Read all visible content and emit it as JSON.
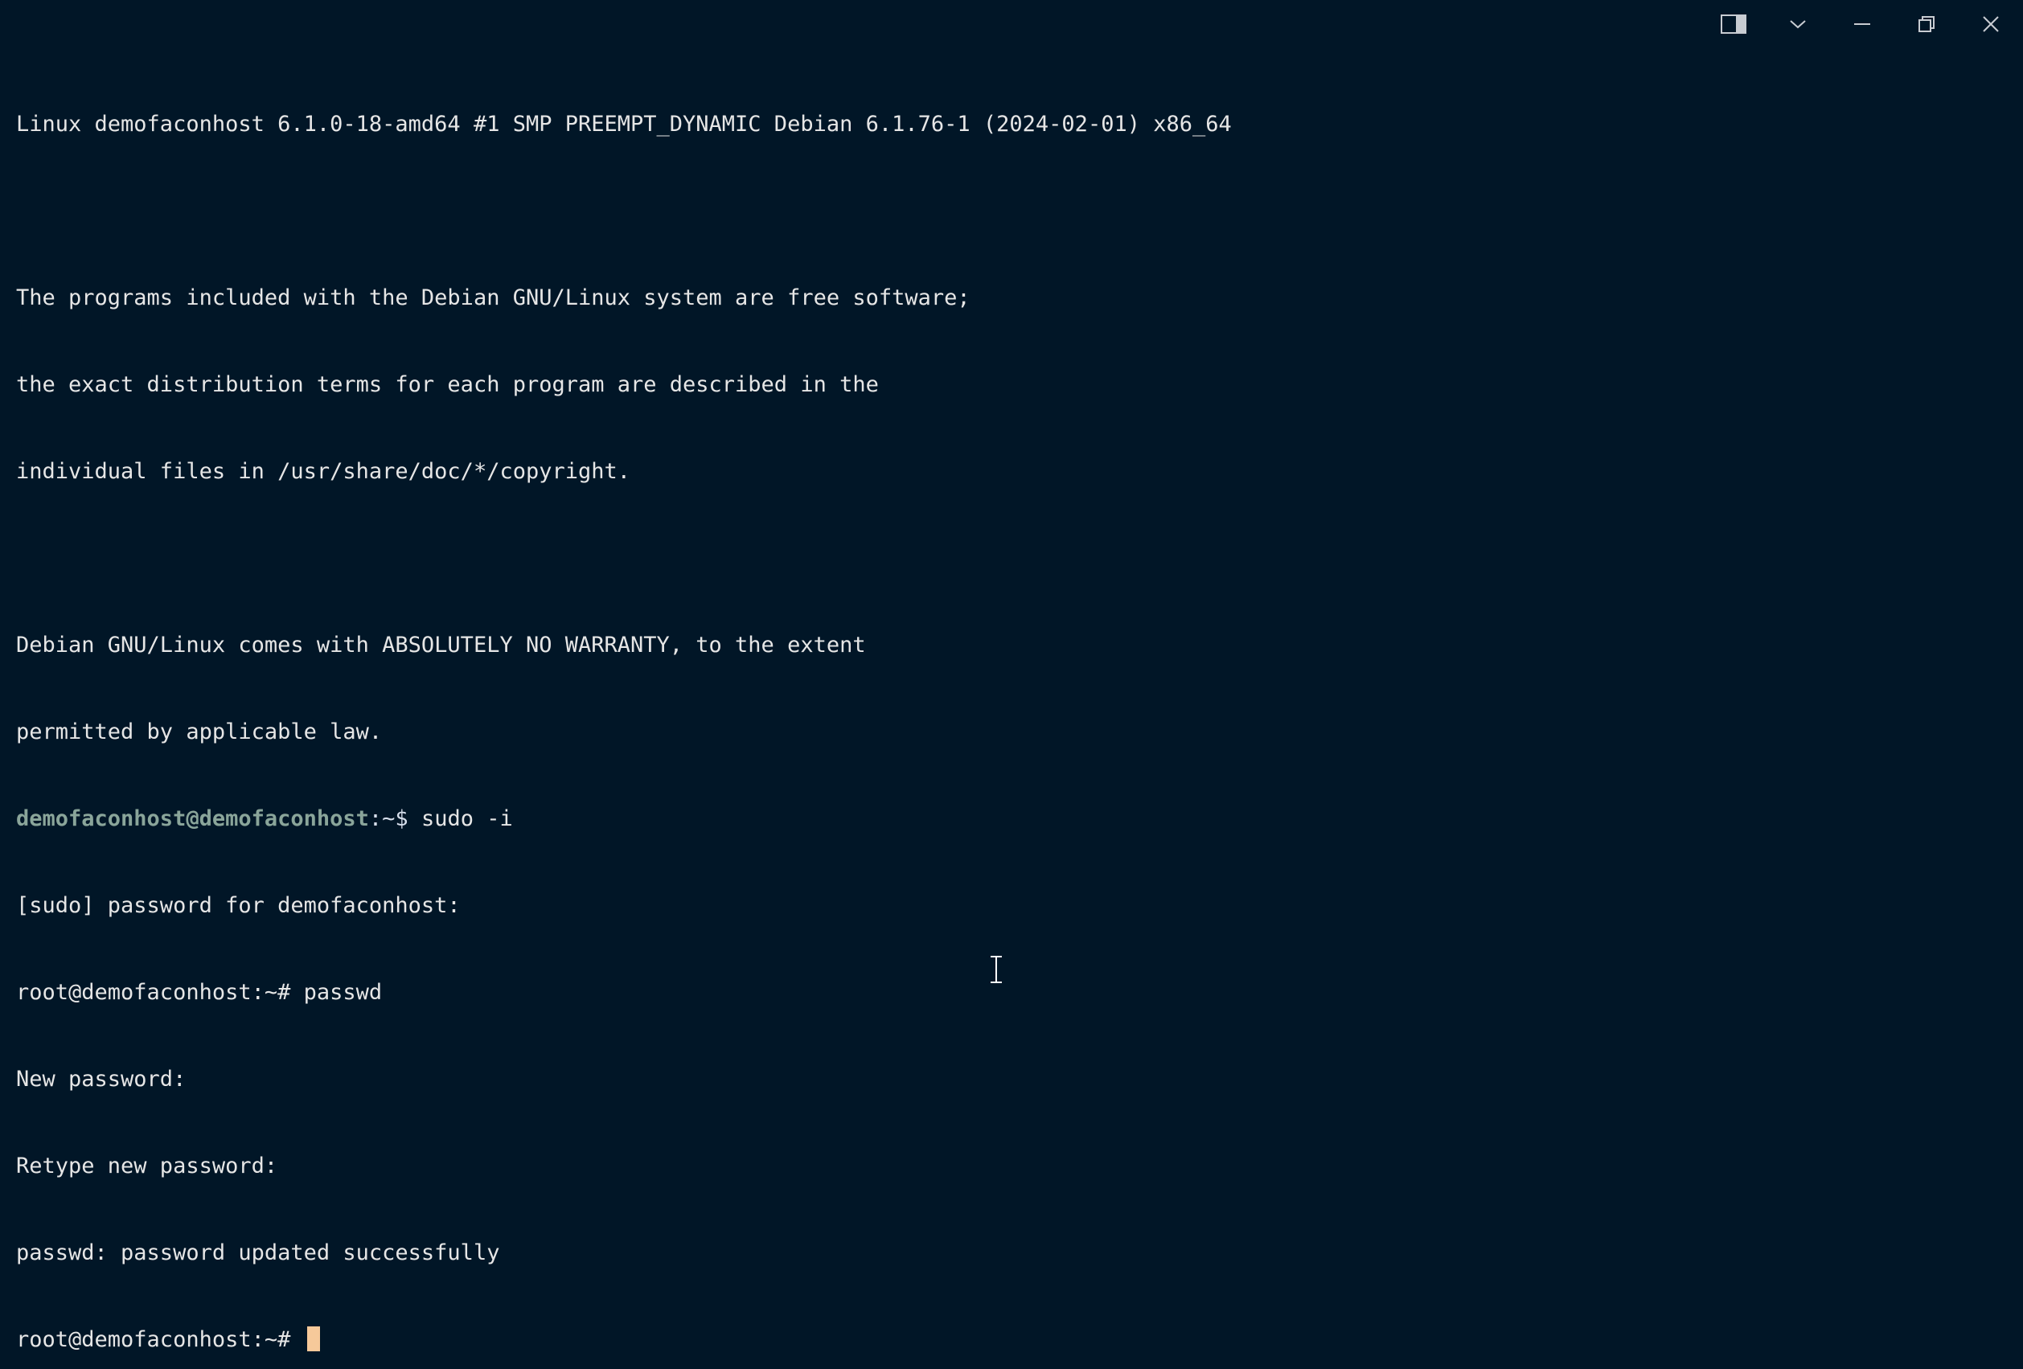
{
  "titlebar": {
    "buttons": [
      {
        "icon": "split-pane-icon"
      },
      {
        "icon": "chevron-down-icon"
      },
      {
        "icon": "minimize-icon"
      },
      {
        "icon": "restore-icon"
      },
      {
        "icon": "close-icon"
      }
    ]
  },
  "terminal": {
    "lines": {
      "l0": "Linux demofaconhost 6.1.0-18-amd64 #1 SMP PREEMPT_DYNAMIC Debian 6.1.76-1 (2024-02-01) x86_64",
      "l1": "",
      "l2": "The programs included with the Debian GNU/Linux system are free software;",
      "l3": "the exact distribution terms for each program are described in the",
      "l4": "individual files in /usr/share/doc/*/copyright.",
      "l5": "",
      "l6": "Debian GNU/Linux comes with ABSOLUTELY NO WARRANTY, to the extent",
      "l7": "permitted by applicable law.",
      "l9": "[sudo] password for demofaconhost:",
      "l10": "root@demofaconhost:~# passwd",
      "l11": "New password:",
      "l12": "Retype new password:",
      "l13": "passwd: password updated successfully"
    },
    "user_prompt": {
      "user_host": "demofaconhost@demofaconhost",
      "path": ":~$ ",
      "command": "sudo -i"
    },
    "root_prompt": "root@demofaconhost:~# "
  },
  "colors": {
    "background": "#011627",
    "text": "#e6e6e6",
    "prompt_user": "#8aa59a",
    "cursor": "#f6c99a"
  }
}
